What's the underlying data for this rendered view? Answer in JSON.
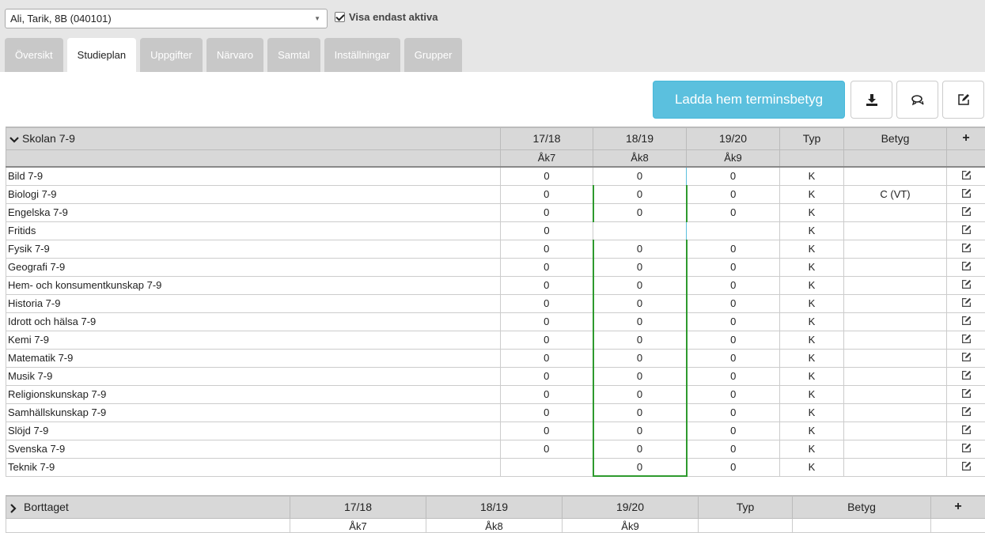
{
  "student_selector": {
    "value": "Ali, Tarik, 8B (040101)"
  },
  "active_filter": {
    "label": "Visa endast aktiva",
    "checked": true
  },
  "tabs": [
    {
      "label": "Översikt"
    },
    {
      "label": "Studieplan"
    },
    {
      "label": "Uppgifter"
    },
    {
      "label": "Närvaro"
    },
    {
      "label": "Samtal"
    },
    {
      "label": "Inställningar"
    },
    {
      "label": "Grupper"
    }
  ],
  "active_tab": "Studieplan",
  "toolbar": {
    "download_grades_label": "Ladda hem terminsbetyg",
    "icons": [
      "download-icon",
      "comments-icon",
      "edit-icon"
    ]
  },
  "colors": {
    "accent": "#5bc0de",
    "tab_inactive": "#c8c8c8",
    "section_border": "#d63384",
    "ak8_highlight": "#2e9a2e"
  },
  "school_section": {
    "title": "Skolan 7-9",
    "columns": [
      "17/18",
      "18/19",
      "19/20",
      "Typ",
      "Betyg"
    ],
    "add_symbol": "+",
    "sub_columns": [
      "Åk7",
      "Åk8",
      "Åk9"
    ],
    "rows": [
      {
        "subject": "Bild 7-9",
        "y1": "0",
        "y2": "0",
        "y3": "0",
        "typ": "K",
        "betyg": ""
      },
      {
        "subject": "Biologi 7-9",
        "y1": "0",
        "y2": "0",
        "y3": "0",
        "typ": "K",
        "betyg": "C (VT)"
      },
      {
        "subject": "Engelska 7-9",
        "y1": "0",
        "y2": "0",
        "y3": "0",
        "typ": "K",
        "betyg": ""
      },
      {
        "subject": "Fritids",
        "y1": "0",
        "y2": "",
        "y3": "",
        "typ": "K",
        "betyg": ""
      },
      {
        "subject": "Fysik 7-9",
        "y1": "0",
        "y2": "0",
        "y3": "0",
        "typ": "K",
        "betyg": ""
      },
      {
        "subject": "Geografi 7-9",
        "y1": "0",
        "y2": "0",
        "y3": "0",
        "typ": "K",
        "betyg": ""
      },
      {
        "subject": "Hem- och konsumentkunskap 7-9",
        "y1": "0",
        "y2": "0",
        "y3": "0",
        "typ": "K",
        "betyg": ""
      },
      {
        "subject": "Historia 7-9",
        "y1": "0",
        "y2": "0",
        "y3": "0",
        "typ": "K",
        "betyg": ""
      },
      {
        "subject": "Idrott och hälsa 7-9",
        "y1": "0",
        "y2": "0",
        "y3": "0",
        "typ": "K",
        "betyg": ""
      },
      {
        "subject": "Kemi 7-9",
        "y1": "0",
        "y2": "0",
        "y3": "0",
        "typ": "K",
        "betyg": ""
      },
      {
        "subject": "Matematik 7-9",
        "y1": "0",
        "y2": "0",
        "y3": "0",
        "typ": "K",
        "betyg": ""
      },
      {
        "subject": "Musik 7-9",
        "y1": "0",
        "y2": "0",
        "y3": "0",
        "typ": "K",
        "betyg": ""
      },
      {
        "subject": "Religionskunskap 7-9",
        "y1": "0",
        "y2": "0",
        "y3": "0",
        "typ": "K",
        "betyg": ""
      },
      {
        "subject": "Samhällskunskap 7-9",
        "y1": "0",
        "y2": "0",
        "y3": "0",
        "typ": "K",
        "betyg": ""
      },
      {
        "subject": "Slöjd 7-9",
        "y1": "0",
        "y2": "0",
        "y3": "0",
        "typ": "K",
        "betyg": ""
      },
      {
        "subject": "Svenska 7-9",
        "y1": "0",
        "y2": "0",
        "y3": "0",
        "typ": "K",
        "betyg": ""
      },
      {
        "subject": "Teknik 7-9",
        "y1": "",
        "y2": "0",
        "y3": "0",
        "typ": "K",
        "betyg": ""
      }
    ]
  },
  "removed_section": {
    "title": "Borttaget",
    "columns": [
      "17/18",
      "18/19",
      "19/20",
      "Typ",
      "Betyg"
    ],
    "add_symbol": "+",
    "sub_columns": [
      "Åk7",
      "Åk8",
      "Åk9"
    ]
  }
}
